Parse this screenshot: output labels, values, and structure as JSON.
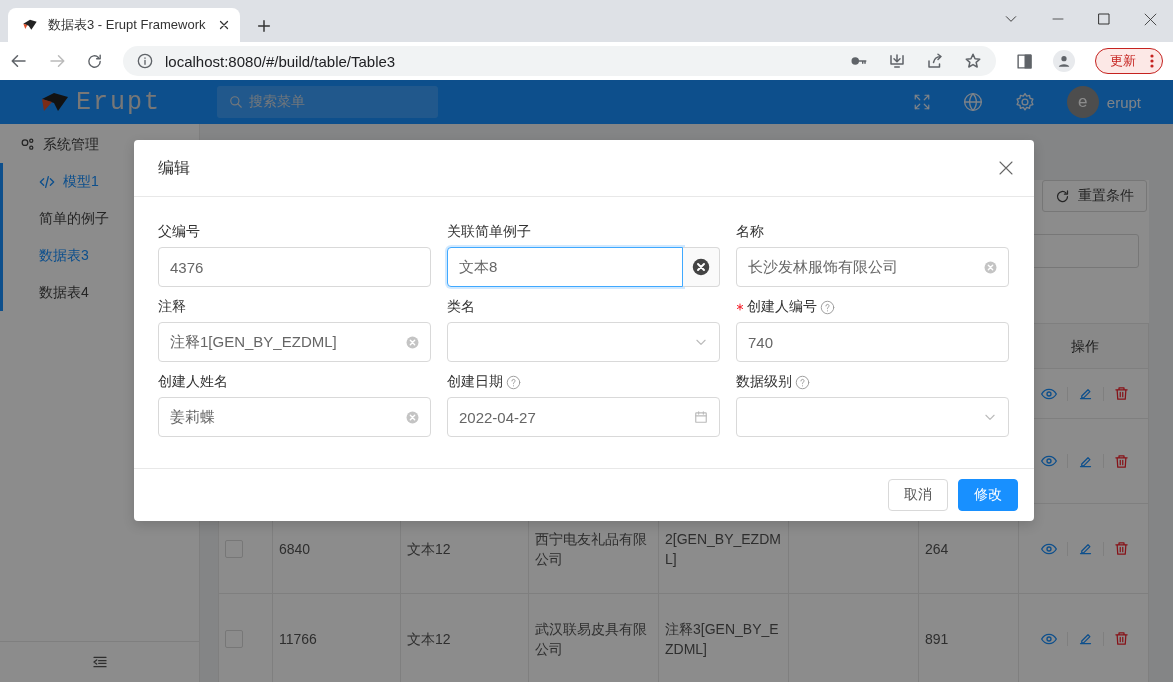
{
  "browser": {
    "tab_title": "数据表3 - Erupt Framework",
    "url": "localhost:8080/#/build/table/Table3",
    "update_button": "更新"
  },
  "header": {
    "logo_text": "Erupt",
    "search_placeholder": "搜索菜单",
    "avatar_letter": "e",
    "user": "erupt"
  },
  "sidebar": {
    "items": [
      {
        "label": "系统管理"
      },
      {
        "label": "模型1",
        "expanded": true,
        "children": [
          {
            "label": "简单的例子",
            "selected": false
          },
          {
            "label": "数据表3",
            "selected": true
          },
          {
            "label": "数据表4",
            "selected": false
          }
        ]
      }
    ]
  },
  "toolbar": {
    "reset_button": "重置条件"
  },
  "table": {
    "action_header": "操作",
    "rows": [
      {
        "kind": "covered"
      },
      {
        "kind": "covered"
      },
      {
        "kind": "data",
        "checked": false,
        "id": "6840",
        "text": "文本12",
        "name": "西宁电友礼品有限公司",
        "note": "2[GEN_BY_EZDML]",
        "number": "264"
      },
      {
        "kind": "data",
        "checked": false,
        "id": "11766",
        "text": "文本12",
        "name": "武汉联易皮具有限公司",
        "note": "注释3[GEN_BY_EZDML]",
        "number": "891"
      }
    ]
  },
  "dialog": {
    "title": "编辑",
    "fields": [
      {
        "label": "父编号",
        "kind": "text",
        "value": "4376",
        "focused": false
      },
      {
        "label": "关联简单例子",
        "kind": "reference",
        "value": "文本8",
        "focused": true
      },
      {
        "label": "名称",
        "kind": "clearable",
        "value": "长沙发林服饰有限公司",
        "focused": false
      },
      {
        "label": "注释",
        "kind": "clearable",
        "value": "注释1[GEN_BY_EZDML]",
        "focused": false
      },
      {
        "label": "类名",
        "kind": "select",
        "focused": false
      },
      {
        "label": "创建人编号",
        "kind": "text",
        "value": "740",
        "required": true,
        "help": true,
        "focused": false
      },
      {
        "label": "创建人姓名",
        "kind": "clearable",
        "value": "姜莉蝶",
        "focused": false
      },
      {
        "label": "创建日期",
        "kind": "date",
        "value": "2022-04-27",
        "help": true,
        "focused": false
      },
      {
        "label": "数据级别",
        "kind": "select",
        "help": true,
        "focused": false
      }
    ],
    "buttons": [
      {
        "label": "取消",
        "kind": "default"
      },
      {
        "label": "修改",
        "kind": "primary"
      }
    ]
  }
}
